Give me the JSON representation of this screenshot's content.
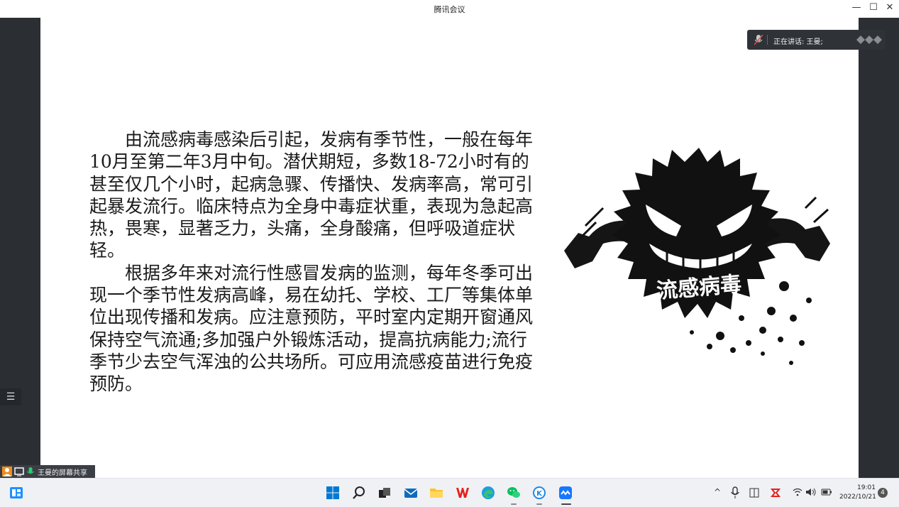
{
  "window": {
    "title": "腾讯会议"
  },
  "speaker": {
    "label": "正在讲话: 王曼;"
  },
  "slide": {
    "paragraph1": "由流感病毒感染后引起，发病有季节性，一般在每年10月至第二年3月中旬。潜伏期短，多数18-72小时有的甚至仅几个小时，起病急骤、传播快、发病率高，常可引起暴发流行。临床特点为全身中毒症状重，表现为急起高热，畏寒，显著乏力，头痛，全身酸痛，但呼吸道症状轻。",
    "paragraph2": "根据多年来对流行性感冒发病的监测，每年冬季可出现一个季节性发病高峰，易在幼托、学校、工厂等集体单位出现传播和发病。应注意预防，平时室内定期开窗通风保持空气流通;多加强户外锻炼活动，提高抗病能力;流行季节少去空气浑浊的公共场所。可应用流感疫苗进行免疫预防。",
    "image_caption": "流感病毒"
  },
  "share": {
    "label": "王曼的屏幕共享"
  },
  "taskbar": {
    "time": "19:01",
    "date": "2022/10/21",
    "notification_count": "4"
  },
  "colors": {
    "dark_bg": "#2b2e33",
    "taskbar_bg": "#f0f1f5",
    "windows_blue": "#0078d4",
    "wps_red": "#e2231a",
    "wechat_green": "#07c160"
  }
}
